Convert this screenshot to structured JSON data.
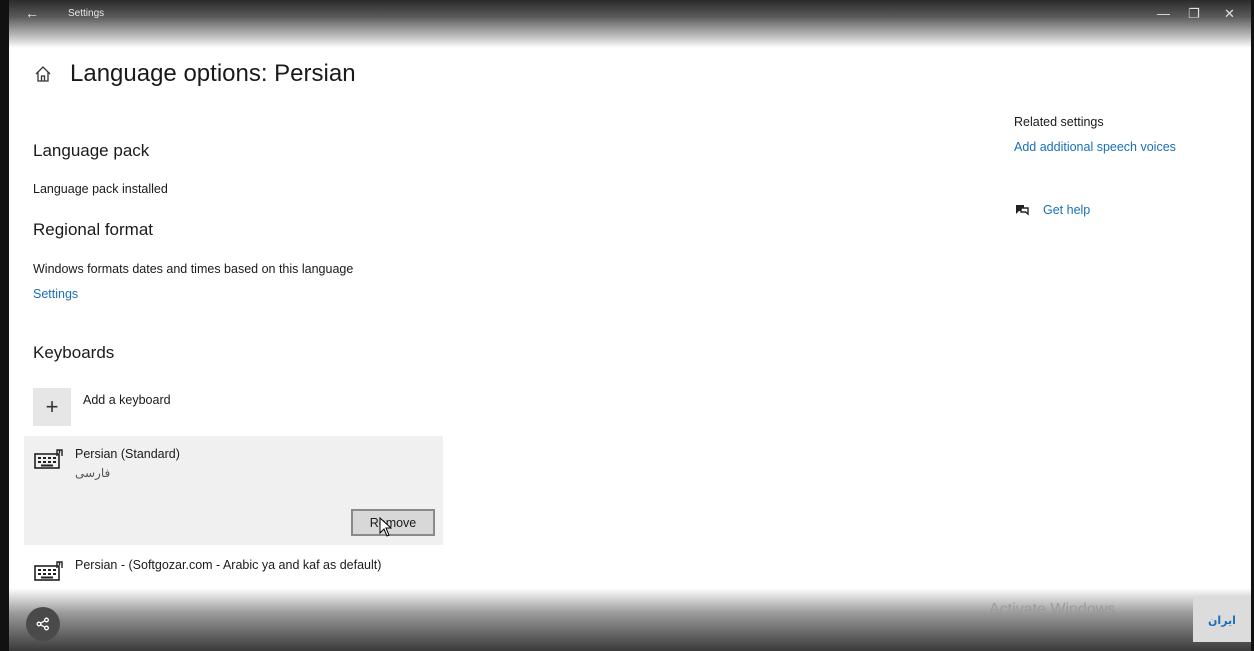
{
  "window": {
    "title": "Settings",
    "back_glyph": "←",
    "minimize_glyph": "—",
    "maximize_glyph": "❐",
    "close_glyph": "✕"
  },
  "page": {
    "title": "Language options: Persian"
  },
  "language_pack": {
    "heading": "Language pack",
    "status": "Language pack installed"
  },
  "regional_format": {
    "heading": "Regional format",
    "description": "Windows formats dates and times based on this language",
    "settings_link": "Settings"
  },
  "keyboards": {
    "heading": "Keyboards",
    "add_label": "Add a keyboard",
    "add_glyph": "+",
    "items": [
      {
        "name": "Persian (Standard)",
        "subtitle": "فارسی",
        "remove_label": "Remove"
      },
      {
        "name": "Persian - (Softgozar.com - Arabic ya and kaf as default)"
      }
    ]
  },
  "sidebar": {
    "related_title": "Related settings",
    "speech_link": "Add additional speech voices",
    "help_label": "Get help"
  },
  "overlay": {
    "activate_text": "Activate Windows",
    "logo_text": "ایران"
  },
  "colors": {
    "link": "#1a6fb8",
    "selected_bg": "#f0f0f0"
  }
}
